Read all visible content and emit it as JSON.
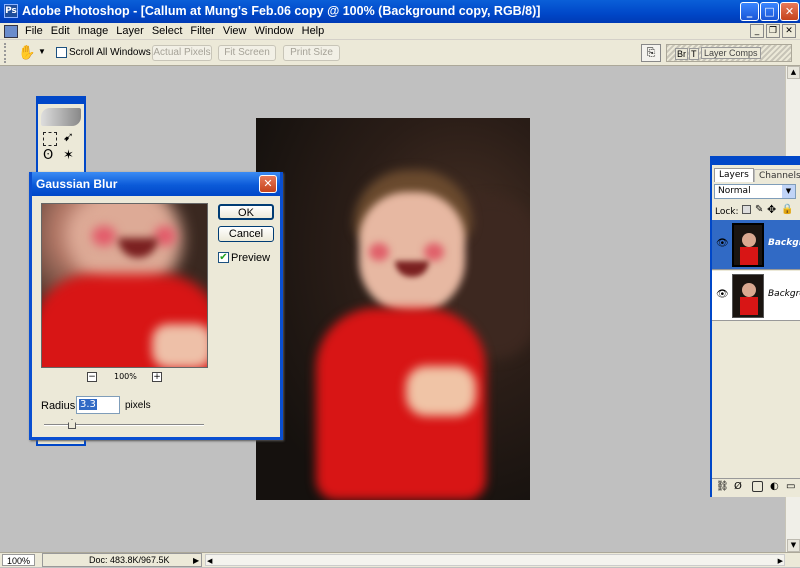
{
  "window": {
    "title": "Adobe Photoshop - [Callum at Mung's Feb.06 copy @ 100% (Background copy, RGB/8)]",
    "app_icon": "photoshop-icon"
  },
  "menu": [
    "File",
    "Edit",
    "Image",
    "Layer",
    "Select",
    "Filter",
    "View",
    "Window",
    "Help"
  ],
  "options": {
    "scroll_all_label": "Scroll All Windows",
    "actual_pixels": "Actual Pixels",
    "fit_screen": "Fit Screen",
    "print_size": "Print Size",
    "palette_well_label": "Layer Comps",
    "palette_tabs": [
      "Br",
      "T"
    ]
  },
  "dialog": {
    "title": "Gaussian Blur",
    "ok": "OK",
    "cancel": "Cancel",
    "preview_label": "Preview",
    "preview_checked": true,
    "zoom": "100%",
    "zoom_out": "−",
    "zoom_in": "+",
    "radius_label": "Radius:",
    "radius_value": "3.3",
    "radius_unit": "pixels"
  },
  "layers": {
    "tabs": [
      "Layers",
      "Channels"
    ],
    "blend_mode": "Normal",
    "lock_label": "Lock:",
    "items": [
      {
        "name": "Backgro",
        "selected": true
      },
      {
        "name": "Backgro",
        "selected": false
      }
    ]
  },
  "status": {
    "zoom": "100%",
    "doc": "Doc: 483.8K/967.5K"
  },
  "colors": {
    "xp_blue": "#0047c8",
    "dialog_bg": "#ece9d8",
    "selected_layer": "#316ac5",
    "shirt_red": "#d81515"
  }
}
